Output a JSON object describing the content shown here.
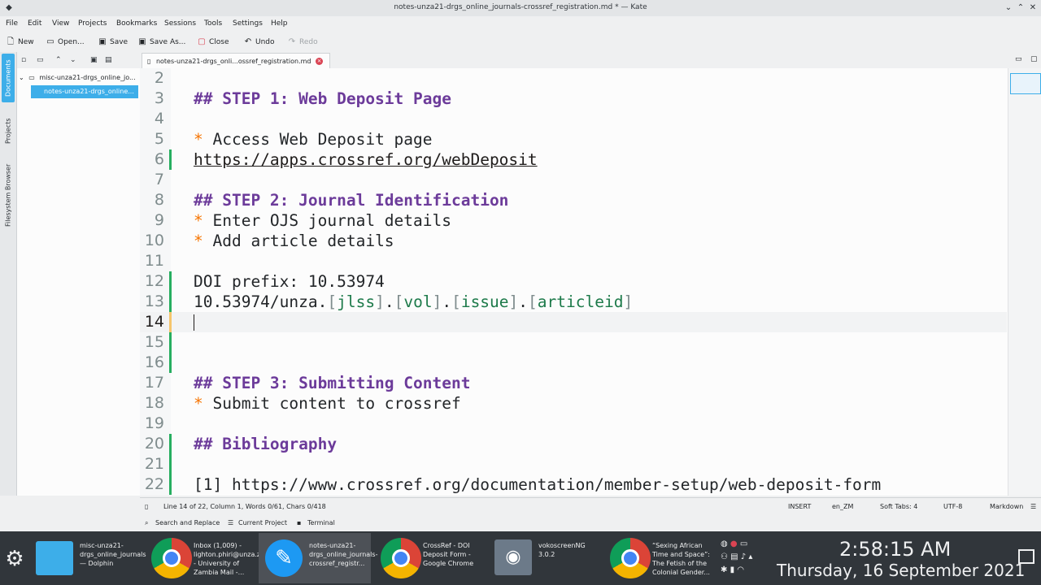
{
  "window": {
    "title": "notes-unza21-drgs_online_journals-crossref_registration.md * — Kate"
  },
  "menu": [
    "File",
    "Edit",
    "View",
    "Projects",
    "Bookmarks",
    "Sessions",
    "Tools",
    "Settings",
    "Help"
  ],
  "toolbar": {
    "new": "New",
    "open": "Open...",
    "save": "Save",
    "save_as": "Save As...",
    "close": "Close",
    "undo": "Undo",
    "redo": "Redo"
  },
  "side_tabs": {
    "documents": "Documents",
    "projects": "Projects",
    "filesystem": "Filesystem Browser"
  },
  "tree": {
    "folder": "misc-unza21-drgs_online_jo...",
    "file": "notes-unza21-drgs_online..."
  },
  "tab": {
    "label": "notes-unza21-drgs_onli...ossref_registration.md"
  },
  "editor": {
    "lines": [
      {
        "n": "2",
        "text": ""
      },
      {
        "n": "3",
        "text": "## STEP 1: Web Deposit Page"
      },
      {
        "n": "4",
        "text": ""
      },
      {
        "n": "5",
        "bullet": "*",
        "text": " Access Web Deposit page"
      },
      {
        "n": "6",
        "text": "https://apps.crossref.org/webDeposit"
      },
      {
        "n": "7",
        "text": ""
      },
      {
        "n": "8",
        "text": "## STEP 2: Journal Identification"
      },
      {
        "n": "9",
        "bullet": "*",
        "text": " Enter OJS journal details"
      },
      {
        "n": "10",
        "bullet": "*",
        "text": " Add article details"
      },
      {
        "n": "11",
        "text": ""
      },
      {
        "n": "12",
        "text": "DOI prefix: 10.53974"
      },
      {
        "n": "13",
        "prefix": "10.53974/unza.",
        "p1": "jlss",
        "p2": "vol",
        "p3": "issue",
        "p4": "articleid"
      },
      {
        "n": "14",
        "text": ""
      },
      {
        "n": "15",
        "text": ""
      },
      {
        "n": "16",
        "text": ""
      },
      {
        "n": "17",
        "text": "## STEP 3: Submitting Content"
      },
      {
        "n": "18",
        "bullet": "*",
        "text": " Submit content to crossref"
      },
      {
        "n": "19",
        "text": ""
      },
      {
        "n": "20",
        "text": "## Bibliography"
      },
      {
        "n": "21",
        "text": ""
      },
      {
        "n": "22",
        "text": "[1] https://www.crossref.org/documentation/member-setup/web-deposit-form"
      }
    ]
  },
  "status": {
    "position": "Line 14 of 22, Column 1, Words 0/61, Chars 0/418",
    "mode": "INSERT",
    "lang": "en_ZM",
    "tabs": "Soft Tabs: 4",
    "encoding": "UTF-8",
    "syntax": "Markdown"
  },
  "bottom_tools": {
    "search": "Search and Replace",
    "project": "Current Project",
    "terminal": "Terminal"
  },
  "taskbar": {
    "tasks": [
      "misc-unza21-drgs_online_journals — Dolphin",
      "Inbox (1,009) - lighton.phiri@unza.zm - University of Zambia Mail -...",
      "notes-unza21-drgs_online_journals-crossref_registr...",
      "CrossRef - DOI Deposit Form - Google Chrome",
      "vokoscreenNG 3.0.2",
      "“Sexing African Time and Space”: The Fetish of the Colonial Gender..."
    ],
    "time": "2:58:15 AM",
    "date": "Thursday, 16 September 2021"
  }
}
